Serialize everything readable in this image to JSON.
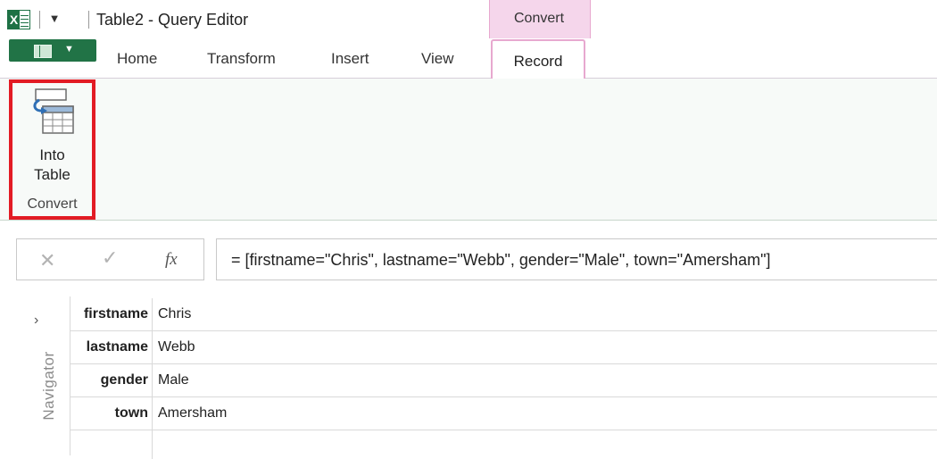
{
  "window": {
    "title": "Table2 - Query Editor",
    "context_tab_group": "Convert"
  },
  "tabs": [
    {
      "label": "Home"
    },
    {
      "label": "Transform"
    },
    {
      "label": "Insert"
    },
    {
      "label": "View"
    },
    {
      "label": "Record",
      "active": true
    }
  ],
  "ribbon": {
    "into_table": {
      "line1": "Into",
      "line2": "Table"
    },
    "group_label": "Convert"
  },
  "formula_bar": {
    "cancel_symbol": "✕",
    "enter_symbol": "✓",
    "fx_label": "fx",
    "formula": "= [firstname=\"Chris\", lastname=\"Webb\", gender=\"Male\", town=\"Amersham\"]"
  },
  "navigator": {
    "label": "Navigator",
    "chevron": "›"
  },
  "record": [
    {
      "key": "firstname",
      "value": "Chris"
    },
    {
      "key": "lastname",
      "value": "Webb"
    },
    {
      "key": "gender",
      "value": "Male"
    },
    {
      "key": "town",
      "value": "Amersham"
    }
  ],
  "colors": {
    "excel_green": "#217346",
    "context_pink": "#f5d6eb",
    "highlight_red": "#e21b24"
  },
  "icons": {
    "app": "excel-icon",
    "qat": "customize-qat-icon",
    "file": "file-menu-icon",
    "into_table": "into-table-icon"
  }
}
